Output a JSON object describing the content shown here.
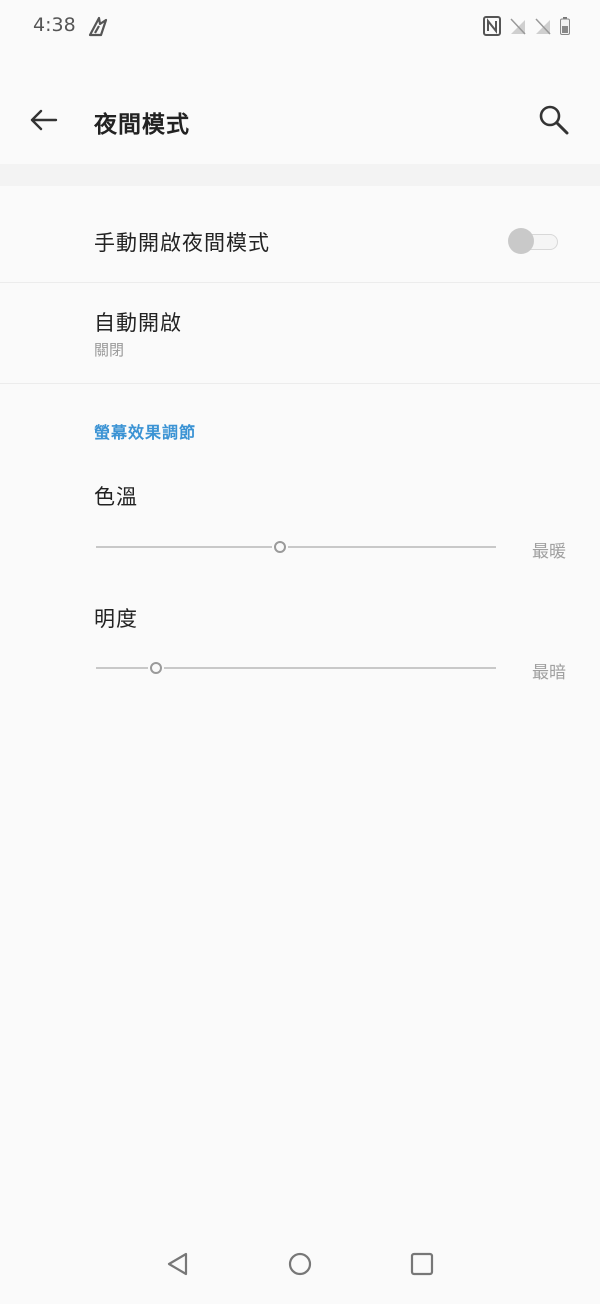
{
  "status_bar": {
    "time": "4:38",
    "app_icon": "app-notification-icon",
    "icons": [
      "nfc-icon",
      "signal-off-icon",
      "signal-off-icon",
      "battery-icon"
    ]
  },
  "app_bar": {
    "title": "夜間模式",
    "back_icon": "arrow-back-icon",
    "search_icon": "search-icon"
  },
  "settings": {
    "manual": {
      "title": "手動開啟夜間模式",
      "toggle_on": false
    },
    "auto": {
      "title": "自動開啟",
      "value": "關閉"
    }
  },
  "display_adjust": {
    "section_title": "螢幕效果調節",
    "color_temp": {
      "label": "色溫",
      "end_label": "最暖",
      "value": 0.46
    },
    "brightness": {
      "label": "明度",
      "end_label": "最暗",
      "value": 0.15
    }
  },
  "nav_bar": {
    "icons": [
      "back-triangle-icon",
      "home-circle-icon",
      "recents-square-icon"
    ]
  },
  "colors": {
    "accent": "#3b93d4",
    "background": "#fafafa",
    "toggle_off": "#c9c9c9"
  }
}
